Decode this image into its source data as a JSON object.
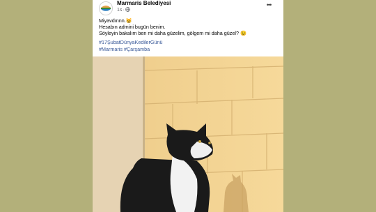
{
  "post": {
    "page_name": "Marmaris Belediyesi",
    "time": "1s",
    "dot": "·",
    "more_glyph": "•••",
    "lines": [
      "Miyavdınnn.😸",
      "Hesabın admini bugün benim.",
      "Söyleyin bakalım ben mi daha güzelim, gölgem mi daha güzel? 😉"
    ],
    "hashtags": [
      "#17ŞubatDünyaKedilerGünü",
      "#Marmaris #Çarşamba"
    ]
  },
  "colors": {
    "background": "#b3b07a",
    "link": "#385898",
    "meta": "#65676b"
  },
  "icons": {
    "avatar": "marmaris-belediyesi-logo",
    "audience": "globe-icon",
    "more": "more-options-icon"
  }
}
